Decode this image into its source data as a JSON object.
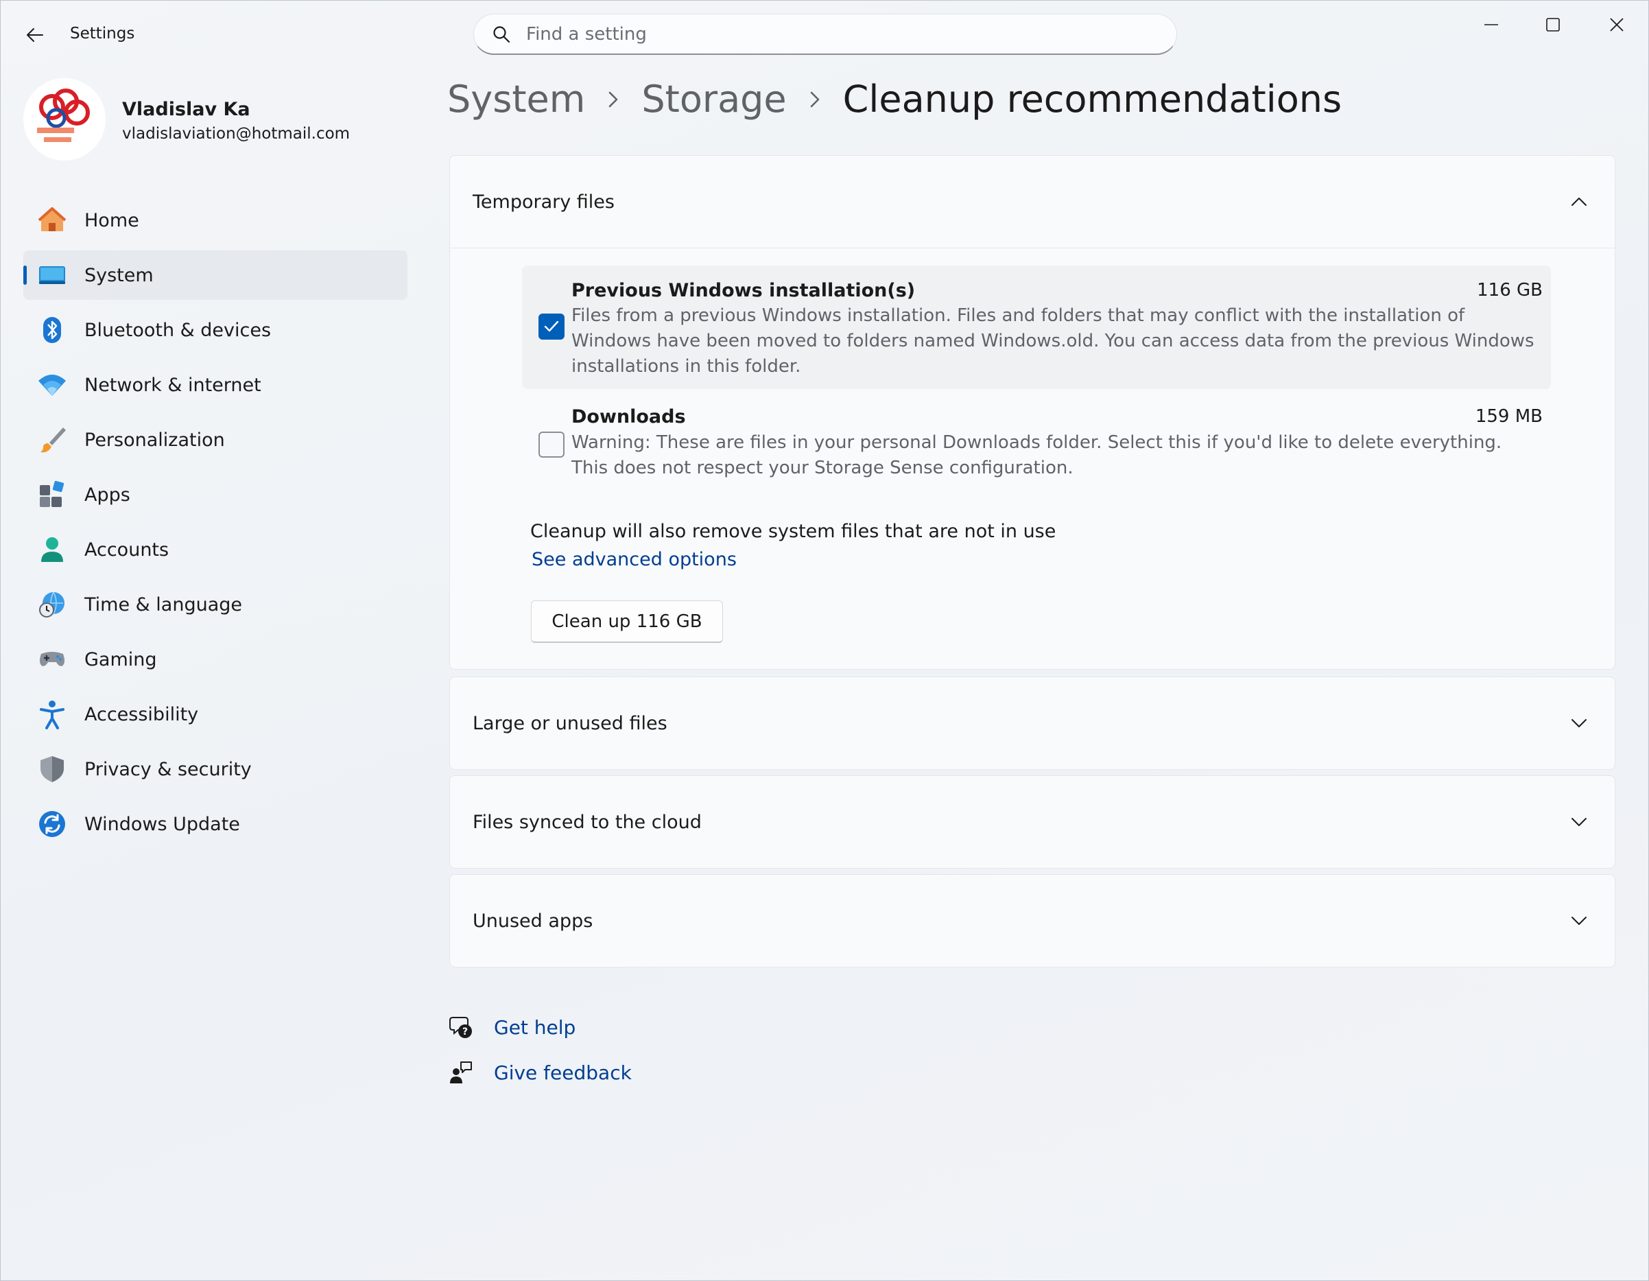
{
  "app": {
    "title": "Settings"
  },
  "search": {
    "placeholder": "Find a setting"
  },
  "user": {
    "name": "Vladislav Ka",
    "email": "vladislaviation@hotmail.com"
  },
  "nav": [
    {
      "label": "Home",
      "icon": "home-icon"
    },
    {
      "label": "System",
      "icon": "system-icon",
      "active": true
    },
    {
      "label": "Bluetooth & devices",
      "icon": "bluetooth-icon"
    },
    {
      "label": "Network & internet",
      "icon": "wifi-icon"
    },
    {
      "label": "Personalization",
      "icon": "brush-icon"
    },
    {
      "label": "Apps",
      "icon": "apps-icon"
    },
    {
      "label": "Accounts",
      "icon": "account-icon"
    },
    {
      "label": "Time & language",
      "icon": "globe-clock-icon"
    },
    {
      "label": "Gaming",
      "icon": "gamepad-icon"
    },
    {
      "label": "Accessibility",
      "icon": "accessibility-icon"
    },
    {
      "label": "Privacy & security",
      "icon": "shield-icon"
    },
    {
      "label": "Windows Update",
      "icon": "update-icon"
    }
  ],
  "breadcrumb": {
    "level1": "System",
    "level2": "Storage",
    "current": "Cleanup recommendations"
  },
  "temp_files": {
    "title": "Temporary files",
    "items": [
      {
        "title": "Previous Windows installation(s)",
        "size": "116 GB",
        "checked": true,
        "description": "Files from a previous Windows installation.  Files and folders that may conflict with the installation of Windows have been moved to folders named Windows.old.  You can access data from the previous Windows installations in this folder."
      },
      {
        "title": "Downloads",
        "size": "159 MB",
        "checked": false,
        "description": "Warning: These are files in your personal Downloads folder. Select this if you'd like to delete everything. This does not respect your Storage Sense configuration."
      }
    ],
    "note": "Cleanup will also remove system files that are not in use",
    "advanced_link": "See advanced options",
    "cleanup_button": "Clean up 116 GB"
  },
  "sections": {
    "large_files": "Large or unused files",
    "cloud_files": "Files synced to the cloud",
    "unused_apps": "Unused apps"
  },
  "help": {
    "get_help": "Get help",
    "give_feedback": "Give feedback"
  },
  "colors": {
    "accent": "#005fb8",
    "link": "#003e92"
  }
}
